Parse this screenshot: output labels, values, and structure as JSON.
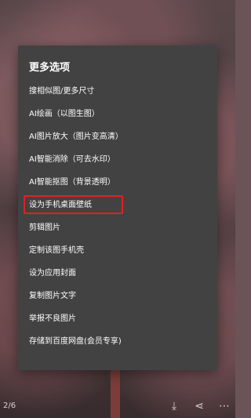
{
  "sheet": {
    "title": "更多选项",
    "items": [
      {
        "label": "搜相似图/更多尺寸"
      },
      {
        "label": "AI绘画（以图生图）"
      },
      {
        "label": "AI图片放大（图片变高清）"
      },
      {
        "label": "AI智能消除（可去水印）"
      },
      {
        "label": "AI智能抠图（背景透明）"
      },
      {
        "label": "设为手机桌面壁纸",
        "highlighted": true
      },
      {
        "label": "剪辑图片"
      },
      {
        "label": "定制该图手机壳"
      },
      {
        "label": "设为应用封面"
      },
      {
        "label": "复制图片文字"
      },
      {
        "label": "举报不良图片"
      },
      {
        "label": "存储到百度网盘(会员专享)"
      }
    ]
  },
  "bottom_bar": {
    "counter": "2/6",
    "icons": [
      "download-icon",
      "share-icon",
      "more-icon"
    ]
  },
  "colors": {
    "sheet_background": "#424242",
    "text": "#ffffff",
    "highlight_border": "#e51e25"
  }
}
